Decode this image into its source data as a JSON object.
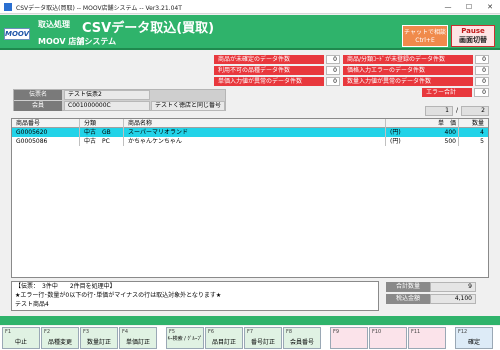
{
  "window": {
    "title": "CSVデータ取込(買取) -- MOOV店舗システム -- Ver3.21.04T",
    "minimize": "—",
    "maximize": "☐",
    "close": "✕"
  },
  "header": {
    "logo": "MOOV",
    "process": "取込処理",
    "title": "CSVデータ取込(買取)",
    "system": "MOOV 店舗システム",
    "chat_line1": "チャットで相談",
    "chat_line2": "Ctrl+E",
    "pause_line1": "Pause",
    "pause_line2": "画面切替",
    "brand_color": "#2fb36b"
  },
  "counters": {
    "left": [
      {
        "label": "商品が未確定のデータ件数",
        "value": "0"
      },
      {
        "label": "利用不可の品種データ件数",
        "value": "0"
      },
      {
        "label": "単価入力値が異常のデータ件数",
        "value": "0"
      }
    ],
    "right": [
      {
        "label": "商品/分類ｺｰﾄﾞが未登録のデータ件数",
        "value": "0"
      },
      {
        "label": "価格入力エラーのデータ件数",
        "value": "0"
      },
      {
        "label": "数量入力値が異常のデータ件数",
        "value": "0"
      }
    ],
    "error": {
      "label": "エラー合計",
      "value": "0"
    }
  },
  "slip": {
    "slip_label": "伝票名",
    "slip_value": "テスト伝票2",
    "member_label": "会員",
    "member_code": "C001000000C",
    "member_name": "テストく徳店と同じ番号"
  },
  "pager": {
    "current": "1",
    "separator": "/",
    "total": "2"
  },
  "table": {
    "columns": [
      "商品番号",
      "分類",
      "商品名称",
      "単　価",
      "数量"
    ],
    "rows": [
      {
        "code": "G0005620",
        "cond": "中古",
        "cls": "GB",
        "name": "スーパーマリオランド",
        "unit": "(円)",
        "price": "400",
        "qty": "4",
        "selected": true
      },
      {
        "code": "G0005086",
        "cond": "中古",
        "cls": "PC",
        "name": "かちゃんケンちゃん",
        "unit": "(円)",
        "price": "500",
        "qty": "5",
        "selected": false
      }
    ]
  },
  "message": {
    "line1": "【伝票：　3件中　　2件目を処理中】",
    "line2": "★エラー行･数量が0以下の行･単価がマイナスの行は取込対象外となります★",
    "line3": "テスト商品4"
  },
  "totals": {
    "qty_label": "合計数量",
    "qty_value": "9",
    "amount_label": "税込金額",
    "amount_value": "4,100"
  },
  "fkeys": [
    {
      "key": "F1",
      "label": "中止"
    },
    {
      "key": "F2",
      "label": "品種変更"
    },
    {
      "key": "F3",
      "label": "数量訂正"
    },
    {
      "key": "F4",
      "label": "単価訂正"
    },
    {
      "key": "F5",
      "label": "ｷｰ検索 / ｸﾞﾙｰﾌﾟ"
    },
    {
      "key": "F6",
      "label": "品目訂正"
    },
    {
      "key": "F7",
      "label": "番号訂正"
    },
    {
      "key": "F8",
      "label": "会員番号"
    },
    {
      "key": "F9",
      "label": ""
    },
    {
      "key": "F10",
      "label": ""
    },
    {
      "key": "F11",
      "label": ""
    },
    {
      "key": "F12",
      "label": "確定"
    }
  ]
}
